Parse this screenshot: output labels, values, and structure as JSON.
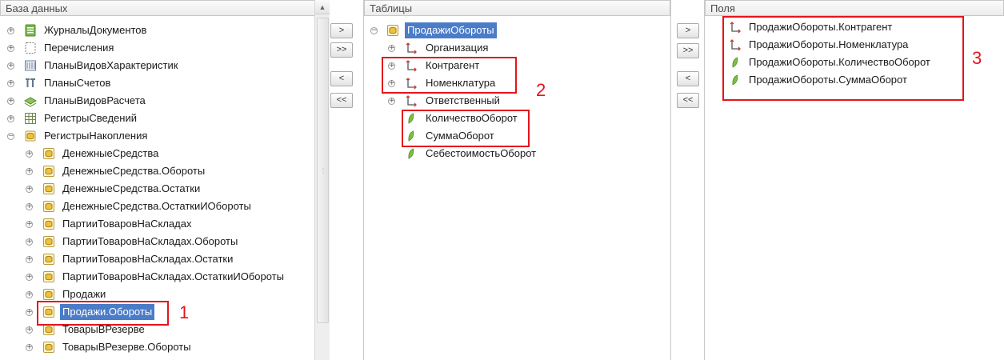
{
  "panels": {
    "db_title": "База данных",
    "tables_title": "Таблицы",
    "fields_title": "Поля"
  },
  "db_tree": [
    {
      "label": "ЖурналыДокументов",
      "icon": "journal-icon"
    },
    {
      "label": "Перечисления",
      "icon": "enum-icon"
    },
    {
      "label": "ПланыВидовХарактеристик",
      "icon": "chart-of-characteristics-icon"
    },
    {
      "label": "ПланыСчетов",
      "icon": "chart-of-accounts-icon"
    },
    {
      "label": "ПланыВидовРасчета",
      "icon": "calculation-types-icon"
    },
    {
      "label": "РегистрыСведений",
      "icon": "info-register-icon"
    },
    {
      "label": "РегистрыНакопления",
      "icon": "accumulation-register-icon"
    },
    {
      "label": "ДенежныеСредства",
      "icon": "virtual-table-icon"
    },
    {
      "label": "ДенежныеСредства.Обороты",
      "icon": "virtual-table-icon"
    },
    {
      "label": "ДенежныеСредства.Остатки",
      "icon": "virtual-table-icon"
    },
    {
      "label": "ДенежныеСредства.ОстаткиИОбороты",
      "icon": "virtual-table-icon"
    },
    {
      "label": "ПартииТоваровНаСкладах",
      "icon": "virtual-table-icon"
    },
    {
      "label": "ПартииТоваровНаСкладах.Обороты",
      "icon": "virtual-table-icon"
    },
    {
      "label": "ПартииТоваровНаСкладах.Остатки",
      "icon": "virtual-table-icon"
    },
    {
      "label": "ПартииТоваровНаСкладах.ОстаткиИОбороты",
      "icon": "virtual-table-icon"
    },
    {
      "label": "Продажи",
      "icon": "virtual-table-icon"
    },
    {
      "label": "Продажи.Обороты",
      "icon": "virtual-table-icon",
      "selected": true
    },
    {
      "label": "ТоварыВРезерве",
      "icon": "virtual-table-icon"
    },
    {
      "label": "ТоварыВРезерве.Обороты",
      "icon": "virtual-table-icon"
    }
  ],
  "tables_tree": [
    {
      "label": "ПродажиОбороты",
      "icon": "virtual-table-icon",
      "selected": true
    },
    {
      "label": "Организация",
      "icon": "dimension-icon"
    },
    {
      "label": "Контрагент",
      "icon": "dimension-icon"
    },
    {
      "label": "Номенклатура",
      "icon": "dimension-icon"
    },
    {
      "label": "Ответственный",
      "icon": "dimension-icon"
    },
    {
      "label": "КоличествоОборот",
      "icon": "resource-icon"
    },
    {
      "label": "СуммаОборот",
      "icon": "resource-icon"
    },
    {
      "label": "СебестоимостьОборот",
      "icon": "resource-icon"
    }
  ],
  "fields": [
    {
      "label": "ПродажиОбороты.Контрагент",
      "icon": "dimension-icon"
    },
    {
      "label": "ПродажиОбороты.Номенклатура",
      "icon": "dimension-icon"
    },
    {
      "label": "ПродажиОбороты.КоличествоОборот",
      "icon": "resource-icon"
    },
    {
      "label": "ПродажиОбороты.СуммаОборот",
      "icon": "resource-icon"
    }
  ],
  "buttons": {
    "add": ">",
    "add_all": ">>",
    "remove": "<",
    "remove_all": "<<"
  },
  "markers": {
    "m1": "1",
    "m2": "2",
    "m3": "3"
  },
  "expander": {
    "plus": "+",
    "minus": "−"
  },
  "colors": {
    "selection": "#4a7cc8",
    "highlight_box": "#e4141c",
    "resource_leaf": "#7cc140"
  }
}
